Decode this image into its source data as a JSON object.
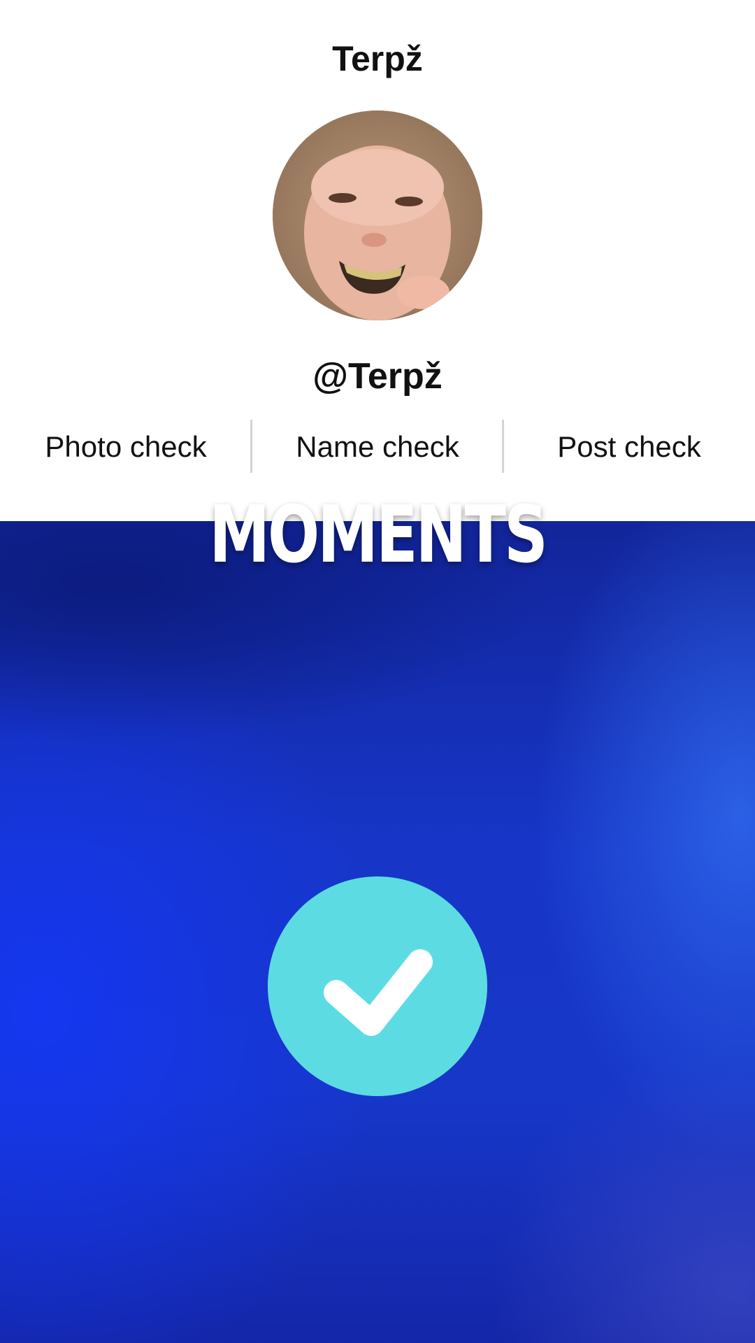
{
  "profile": {
    "title": "Terpž",
    "handle": "@Terpž",
    "avatar_icon": "avatar-photo"
  },
  "check_tabs": [
    {
      "label": "Photo check"
    },
    {
      "label": "Name check"
    },
    {
      "label": "Post check"
    }
  ],
  "overlay": {
    "moments_text": "MOMENTS"
  },
  "verification": {
    "icon": "checkmark-icon",
    "circle_color": "#5cdce2"
  },
  "colors": {
    "background_blue": "#1736c8",
    "accent_teal": "#5cdce2",
    "text": "#111111"
  }
}
